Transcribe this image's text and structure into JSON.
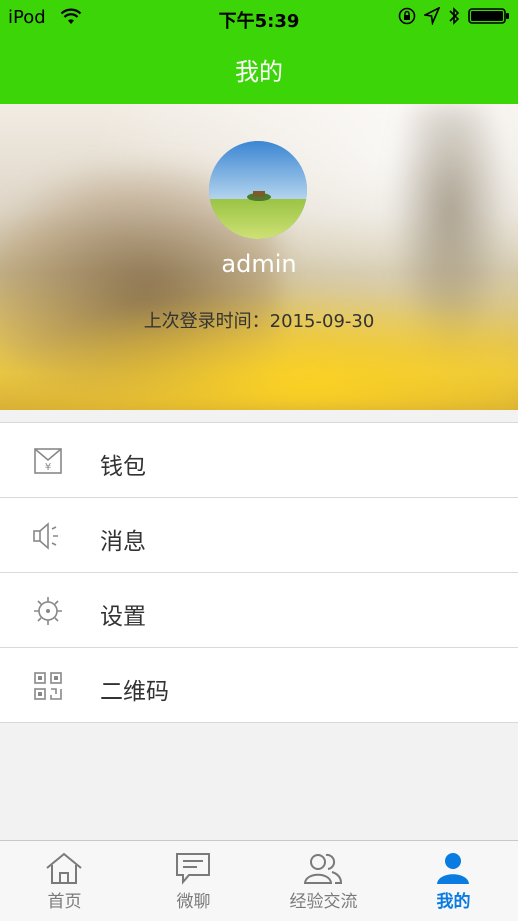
{
  "status_bar": {
    "carrier": "iPod",
    "time": "下午5:39",
    "icons": [
      "wifi-icon",
      "orientation-lock-icon",
      "location-icon",
      "bluetooth-icon",
      "battery-icon"
    ]
  },
  "nav": {
    "title": "我的"
  },
  "profile": {
    "username": "admin",
    "last_login": "上次登录时间：2015-09-30"
  },
  "menu": {
    "items": [
      {
        "label": "钱包",
        "icon": "wallet-icon"
      },
      {
        "label": "消息",
        "icon": "speaker-icon"
      },
      {
        "label": "设置",
        "icon": "settings-icon"
      },
      {
        "label": "二维码",
        "icon": "qr-code-icon"
      }
    ]
  },
  "tabbar": {
    "tabs": [
      {
        "label": "首页",
        "icon": "home-icon"
      },
      {
        "label": "微聊",
        "icon": "chat-icon"
      },
      {
        "label": "经验交流",
        "icon": "users-icon"
      },
      {
        "label": "我的",
        "icon": "person-icon",
        "active": true
      }
    ]
  },
  "colors": {
    "nav_green": "#3bd508",
    "active_tab_blue": "#0a7be0"
  }
}
